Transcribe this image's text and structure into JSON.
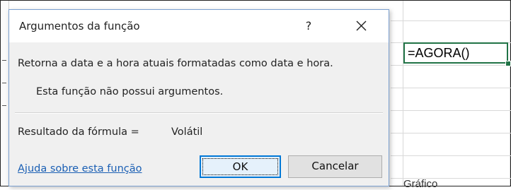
{
  "dialog": {
    "title": "Argumentos da função",
    "help_glyph": "?",
    "close_icon": "close-icon",
    "description": "Retorna a data e a hora atuais formatadas como data e hora.",
    "no_args_message": "Esta função não possui argumentos.",
    "result_label": "Resultado da fórmula =",
    "result_value": "Volátil",
    "help_link": "Ajuda sobre esta função",
    "ok_label": "OK",
    "cancel_label": "Cancelar"
  },
  "sheet": {
    "active_cell_formula": "=AGORA()",
    "partial_text_below": "Gráfico",
    "accent_color": "#217346"
  },
  "colors": {
    "link": "#1a5fb4",
    "dialog_bg": "#f0f0f0",
    "dialog_border": "#7a9fcf",
    "ok_border": "#0078d7"
  }
}
